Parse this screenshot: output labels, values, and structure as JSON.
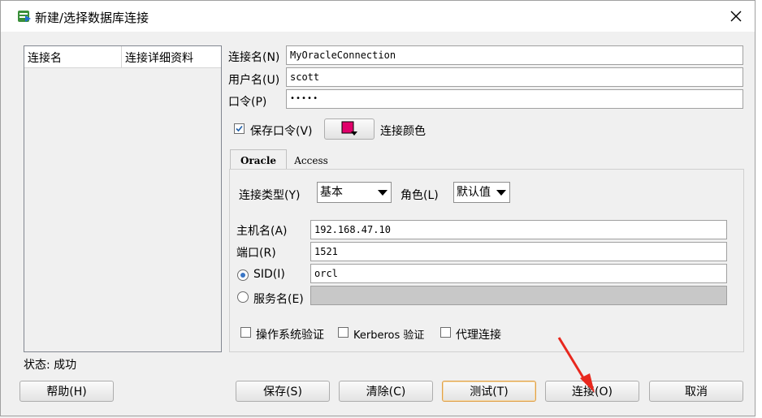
{
  "window": {
    "title": "新建/选择数据库连接"
  },
  "list": {
    "col_name": "连接名",
    "col_details": "连接详细资料"
  },
  "form": {
    "conn_name_label": "连接名(N)",
    "conn_name_value": "MyOracleConnection",
    "username_label": "用户名(U)",
    "username_value": "scott",
    "password_label": "口令(P)",
    "password_value": "•••••",
    "save_password_label": "保存口令(V)",
    "save_password_checked": true,
    "conn_color_label": "连接颜色",
    "conn_color": "#e0006a"
  },
  "tabs": [
    {
      "label": "Oracle",
      "active": true
    },
    {
      "label": "Access",
      "active": false
    }
  ],
  "oracle": {
    "conn_type_label": "连接类型(Y)",
    "conn_type_value": "基本",
    "role_label": "角色(L)",
    "role_value": "默认值",
    "host_label": "主机名(A)",
    "host_value": "192.168.47.10",
    "port_label": "端口(R)",
    "port_value": "1521",
    "sid_label": "SID(I)",
    "sid_value": "orcl",
    "service_label": "服务名(E)",
    "service_value": "",
    "os_auth_label": "操作系统验证",
    "kerberos_label": "Kerberos 验证",
    "proxy_label": "代理连接"
  },
  "status": {
    "text": "状态: 成功"
  },
  "buttons": {
    "help": "帮助(H)",
    "save": "保存(S)",
    "clear": "清除(C)",
    "test": "测试(T)",
    "connect": "连接(O)",
    "cancel": "取消"
  },
  "colors": {
    "accent_arrow": "#e8281e"
  }
}
